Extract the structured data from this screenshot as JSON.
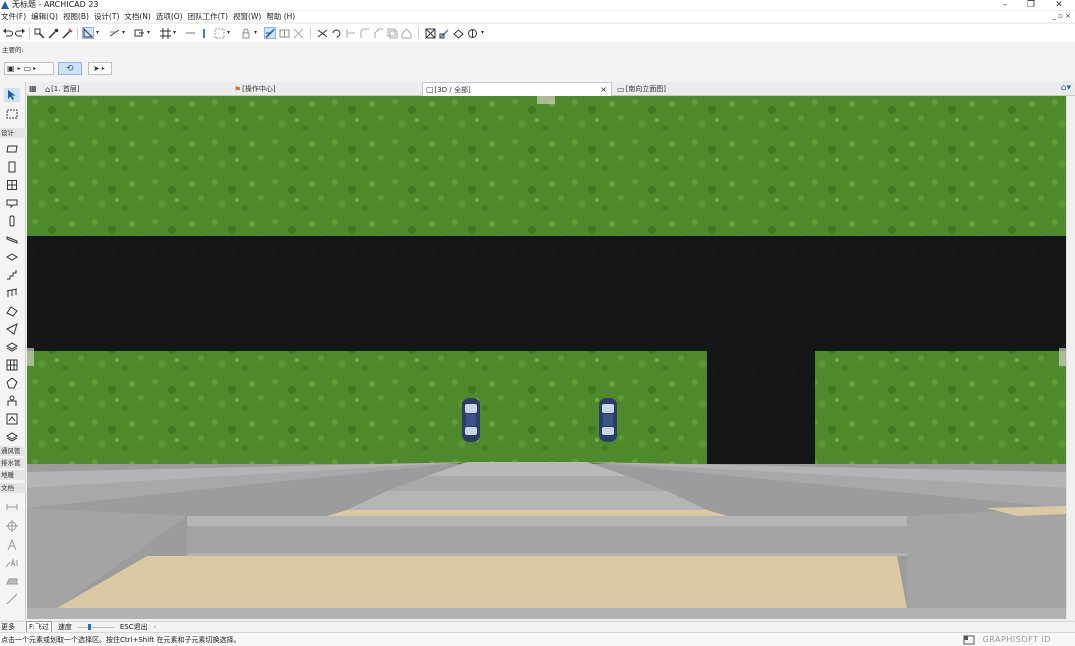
{
  "window": {
    "title": "无标题 - ARCHICAD 23",
    "controls": {
      "minimize": "–",
      "restore": "❐",
      "close": "✕"
    }
  },
  "menu": {
    "items": [
      "文件(F)",
      "编辑(Q)",
      "视图(B)",
      "设计(T)",
      "文档(N)",
      "选项(O)",
      "团队工作(T)",
      "视窗(W)",
      "帮助 (H)"
    ],
    "mdi_controls": "_ ▫ ×"
  },
  "subtoolbar": {
    "label": "主要的:"
  },
  "tabs": [
    {
      "label": "[1. 首层]",
      "icon": "floor-plan-icon"
    },
    {
      "label": "[操作中心]",
      "icon": "action-center-icon"
    },
    {
      "label": "[3D / 全部]",
      "icon": "3d-view-icon",
      "close": "×",
      "active": true
    },
    {
      "label": "[南向立面图]",
      "icon": "elevation-icon"
    }
  ],
  "toolbox": {
    "sections": [
      "设计",
      "通风管",
      "排水管",
      "地暖",
      "文档",
      "更多"
    ]
  },
  "navigation": {
    "mode": "F:飞过",
    "speed_label": "速度",
    "exit": "ESC退出"
  },
  "status": {
    "hint": "点击一个元素或划取一个选择区。按住Ctrl+Shift 在元素和子元素切换选择。",
    "brand": "GRAPHISOFT ID"
  },
  "colors": {
    "grass": "#4f8a2c",
    "road": "#151617",
    "stand": "#9a9a9a",
    "sand": "#dbc9a3",
    "selection": "#cfe3f7"
  },
  "scene": {
    "objects": [
      "grass-top",
      "road",
      "grass-left",
      "grass-right",
      "car-1",
      "car-2",
      "stand-steps"
    ]
  }
}
